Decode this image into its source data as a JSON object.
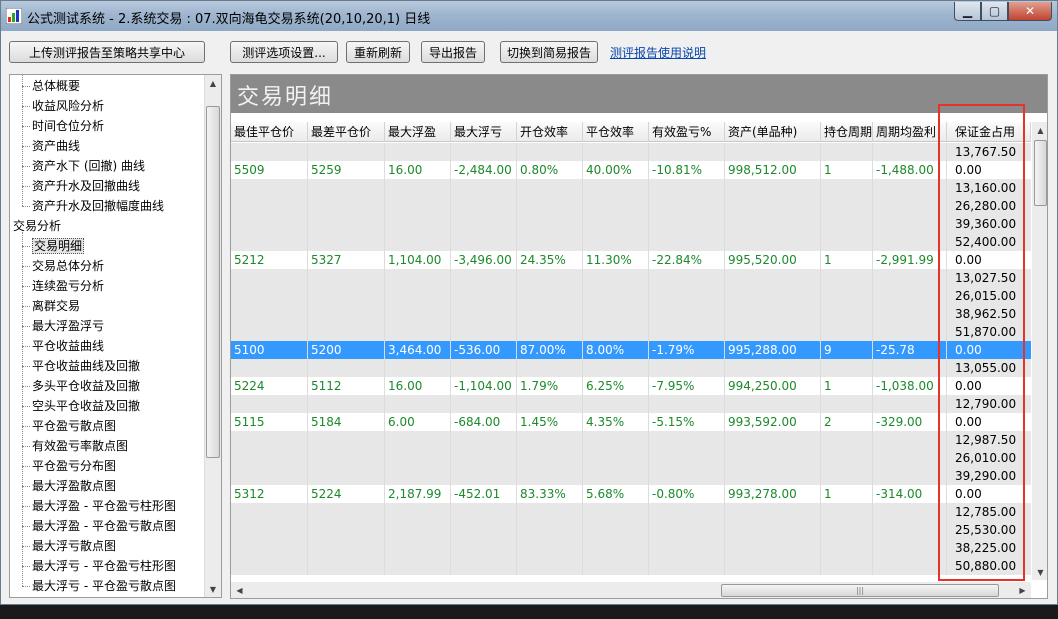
{
  "window": {
    "title": "公式测试系统 - 2.系统交易 : 07.双向海龟交易系统(20,10,20,1) 日线",
    "minimize": "▁",
    "maximize": "▢",
    "close": "✕"
  },
  "toolbar": {
    "upload_label": "上传测评报告至策略共享中心",
    "options_label": "测评选项设置...",
    "refresh_label": "重新刷新",
    "export_label": "导出报告",
    "switch_label": "切换到简易报告",
    "help_link": "测评报告使用说明"
  },
  "tree": {
    "items": [
      {
        "label": "总体概要",
        "level": 1
      },
      {
        "label": "收益风险分析",
        "level": 1
      },
      {
        "label": "时间仓位分析",
        "level": 1
      },
      {
        "label": "资产曲线",
        "level": 1
      },
      {
        "label": "资产水下 (回撤) 曲线",
        "level": 1
      },
      {
        "label": "资产升水及回撤曲线",
        "level": 1
      },
      {
        "label": "资产升水及回撤幅度曲线",
        "level": 1
      },
      {
        "label": "交易分析",
        "level": 0
      },
      {
        "label": "交易明细",
        "level": 1,
        "selected": true
      },
      {
        "label": "交易总体分析",
        "level": 1
      },
      {
        "label": "连续盈亏分析",
        "level": 1
      },
      {
        "label": "离群交易",
        "level": 1
      },
      {
        "label": "最大浮盈浮亏",
        "level": 1
      },
      {
        "label": "平仓收益曲线",
        "level": 1
      },
      {
        "label": "平仓收益曲线及回撤",
        "level": 1
      },
      {
        "label": "多头平仓收益及回撤",
        "level": 1
      },
      {
        "label": "空头平仓收益及回撤",
        "level": 1
      },
      {
        "label": "平仓盈亏散点图",
        "level": 1
      },
      {
        "label": "有效盈亏率散点图",
        "level": 1
      },
      {
        "label": "平仓盈亏分布图",
        "level": 1
      },
      {
        "label": "最大浮盈散点图",
        "level": 1
      },
      {
        "label": "最大浮盈 - 平仓盈亏柱形图",
        "level": 1
      },
      {
        "label": "最大浮盈 - 平仓盈亏散点图",
        "level": 1
      },
      {
        "label": "最大浮亏散点图",
        "level": 1
      },
      {
        "label": "最大浮亏 - 平仓盈亏柱形图",
        "level": 1
      },
      {
        "label": "最大浮亏 - 平仓盈亏散点图",
        "level": 1
      }
    ]
  },
  "panel": {
    "title": "交易明细",
    "columns": [
      "最佳平仓价",
      "最差平仓价",
      "最大浮盈",
      "最大浮亏",
      "开仓效率",
      "平仓效率",
      "有效盈亏%",
      "资产(单品种)",
      "持仓周期",
      "周期均盈利",
      "保证金占用"
    ],
    "rows": [
      {
        "cells": [
          "",
          "",
          "",
          "",
          "",
          "",
          "",
          "",
          "",
          "",
          "13,767.50"
        ],
        "style": "grey"
      },
      {
        "cells": [
          "5509",
          "5259",
          "16.00",
          "-2,484.00",
          "0.80%",
          "40.00%",
          "-10.81%",
          "998,512.00",
          "1",
          "-1,488.00",
          "0.00"
        ],
        "style": "white"
      },
      {
        "cells": [
          "",
          "",
          "",
          "",
          "",
          "",
          "",
          "",
          "",
          "",
          "13,160.00"
        ],
        "style": "grey"
      },
      {
        "cells": [
          "",
          "",
          "",
          "",
          "",
          "",
          "",
          "",
          "",
          "",
          "26,280.00"
        ],
        "style": "grey"
      },
      {
        "cells": [
          "",
          "",
          "",
          "",
          "",
          "",
          "",
          "",
          "",
          "",
          "39,360.00"
        ],
        "style": "grey"
      },
      {
        "cells": [
          "",
          "",
          "",
          "",
          "",
          "",
          "",
          "",
          "",
          "",
          "52,400.00"
        ],
        "style": "grey"
      },
      {
        "cells": [
          "5212",
          "5327",
          "1,104.00",
          "-3,496.00",
          "24.35%",
          "11.30%",
          "-22.84%",
          "995,520.00",
          "1",
          "-2,991.99",
          "0.00"
        ],
        "style": "white"
      },
      {
        "cells": [
          "",
          "",
          "",
          "",
          "",
          "",
          "",
          "",
          "",
          "",
          "13,027.50"
        ],
        "style": "grey"
      },
      {
        "cells": [
          "",
          "",
          "",
          "",
          "",
          "",
          "",
          "",
          "",
          "",
          "26,015.00"
        ],
        "style": "grey"
      },
      {
        "cells": [
          "",
          "",
          "",
          "",
          "",
          "",
          "",
          "",
          "",
          "",
          "38,962.50"
        ],
        "style": "grey"
      },
      {
        "cells": [
          "",
          "",
          "",
          "",
          "",
          "",
          "",
          "",
          "",
          "",
          "51,870.00"
        ],
        "style": "grey"
      },
      {
        "cells": [
          "5100",
          "5200",
          "3,464.00",
          "-536.00",
          "87.00%",
          "8.00%",
          "-1.79%",
          "995,288.00",
          "9",
          "-25.78",
          "0.00"
        ],
        "style": "sel"
      },
      {
        "cells": [
          "",
          "",
          "",
          "",
          "",
          "",
          "",
          "",
          "",
          "",
          "13,055.00"
        ],
        "style": "grey"
      },
      {
        "cells": [
          "5224",
          "5112",
          "16.00",
          "-1,104.00",
          "1.79%",
          "6.25%",
          "-7.95%",
          "994,250.00",
          "1",
          "-1,038.00",
          "0.00"
        ],
        "style": "white"
      },
      {
        "cells": [
          "",
          "",
          "",
          "",
          "",
          "",
          "",
          "",
          "",
          "",
          "12,790.00"
        ],
        "style": "grey"
      },
      {
        "cells": [
          "5115",
          "5184",
          "6.00",
          "-684.00",
          "1.45%",
          "4.35%",
          "-5.15%",
          "993,592.00",
          "2",
          "-329.00",
          "0.00"
        ],
        "style": "white"
      },
      {
        "cells": [
          "",
          "",
          "",
          "",
          "",
          "",
          "",
          "",
          "",
          "",
          "12,987.50"
        ],
        "style": "grey"
      },
      {
        "cells": [
          "",
          "",
          "",
          "",
          "",
          "",
          "",
          "",
          "",
          "",
          "26,010.00"
        ],
        "style": "grey"
      },
      {
        "cells": [
          "",
          "",
          "",
          "",
          "",
          "",
          "",
          "",
          "",
          "",
          "39,290.00"
        ],
        "style": "grey"
      },
      {
        "cells": [
          "5312",
          "5224",
          "2,187.99",
          "-452.01",
          "83.33%",
          "5.68%",
          "-0.80%",
          "993,278.00",
          "1",
          "-314.00",
          "0.00"
        ],
        "style": "white"
      },
      {
        "cells": [
          "",
          "",
          "",
          "",
          "",
          "",
          "",
          "",
          "",
          "",
          "12,785.00"
        ],
        "style": "grey"
      },
      {
        "cells": [
          "",
          "",
          "",
          "",
          "",
          "",
          "",
          "",
          "",
          "",
          "25,530.00"
        ],
        "style": "grey"
      },
      {
        "cells": [
          "",
          "",
          "",
          "",
          "",
          "",
          "",
          "",
          "",
          "",
          "38,225.00"
        ],
        "style": "grey"
      },
      {
        "cells": [
          "",
          "",
          "",
          "",
          "",
          "",
          "",
          "",
          "",
          "",
          "50,880.00"
        ],
        "style": "grey"
      }
    ]
  },
  "colors": {
    "value_text": "#1b8a2a",
    "selected_row": "#3399ff",
    "highlight_box": "#e8312b"
  }
}
